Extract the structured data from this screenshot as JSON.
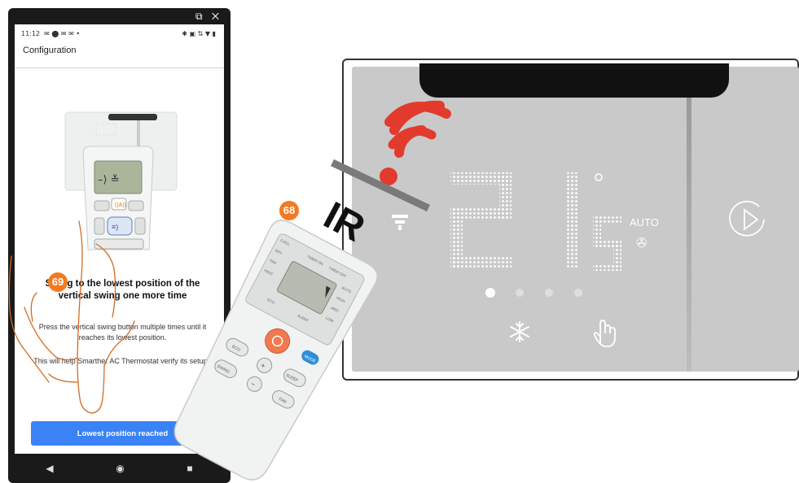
{
  "phone": {
    "window_icons": "⧉ ✕",
    "status_time": "11:12",
    "status_left_icons": "✉ ⬤ ✉ ✉ •",
    "status_right_icons": "✱ ▣ ⇅ ▼ ▮",
    "screen_title": "Configuration",
    "heading_line1": "Swing to the lowest position of the",
    "heading_line2": "vertical swing one more time",
    "instruction_1": "Press the vertical swing button multiple times until it reaches its lowest position.",
    "instruction_2": "This will help Smarther AC Thermostat verify its setup..",
    "primary_button": "Lowest position reached",
    "nav_back": "◀",
    "nav_home": "◉",
    "nav_recent": "■"
  },
  "remote_screen": {
    "segment_text": "–⟩ ≚"
  },
  "remote": {
    "ir_label": "IR",
    "labels": {
      "cool": "COOL",
      "dry": "DRY",
      "fan": "FAN",
      "heat": "HEAT",
      "timer_on": "TIMER ON",
      "timer_off": "TIMER OFF",
      "auto": "AUTO",
      "high": "HIGH",
      "med": "MED",
      "low": "LOW",
      "eco": "ECO",
      "sleep_small": "SLEEP",
      "mode": "MODE",
      "eco_btn": "ECO",
      "swing_btn": "SWING",
      "sleep_btn": "SLEEP",
      "fan_btn": "FAN",
      "plus": "+",
      "minus": "−"
    }
  },
  "thermostat": {
    "mode_label": "AUTO",
    "temperature_digits": [
      "2",
      "1"
    ],
    "page_indicator": {
      "count": 4,
      "active": 1
    }
  },
  "annotations": {
    "step_68": "68",
    "step_69": "69"
  },
  "colors": {
    "accent_blue": "#3b82f6",
    "badge_orange": "#f47a20",
    "signal_red": "#e23b2e",
    "hand_outline": "#d46a1f",
    "power_orange": "#f07a4e"
  }
}
